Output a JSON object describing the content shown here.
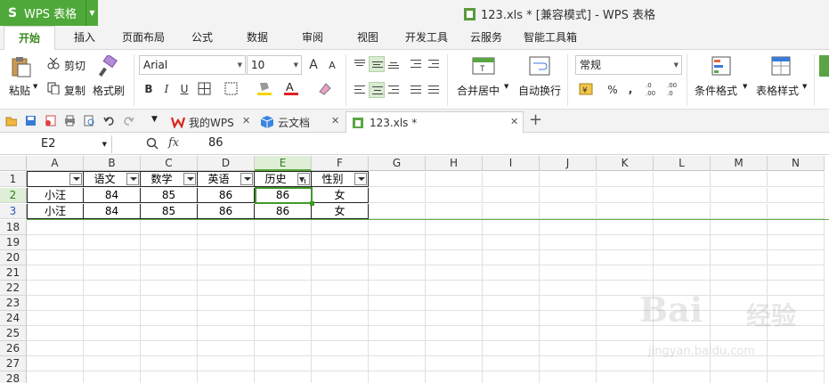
{
  "app": {
    "name": "WPS 表格",
    "logo_glyph": "S"
  },
  "window": {
    "title": "123.xls * [兼容模式] - WPS 表格"
  },
  "menu": {
    "tabs": [
      "开始",
      "插入",
      "页面布局",
      "公式",
      "数据",
      "审阅",
      "视图",
      "开发工具",
      "云服务",
      "智能工具箱"
    ],
    "active": "开始"
  },
  "ribbon": {
    "paste": "粘贴",
    "cut": "剪切",
    "copy": "复制",
    "format_painter": "格式刷",
    "font_name": "Arial",
    "font_size": "10",
    "font_grow": "A",
    "font_shrink": "A",
    "bold": "B",
    "italic": "I",
    "underline": "U",
    "merge_center": "合并居中",
    "wrap_text": "自动换行",
    "number_format": "常规",
    "percent": "%",
    "comma": ",",
    "conditional_format": "条件格式",
    "table_style": "表格样式"
  },
  "doc_tabs": [
    {
      "label": "我的WPS",
      "icon": "wps-logo-icon"
    },
    {
      "label": "云文档",
      "icon": "cloud-cube-icon"
    },
    {
      "label": "123.xls *",
      "icon": "sheet-file-icon"
    }
  ],
  "formula_bar": {
    "cell_ref": "E2",
    "fx": "fx",
    "value": "86"
  },
  "sheet": {
    "columns": [
      "A",
      "B",
      "C",
      "D",
      "E",
      "F",
      "G",
      "H",
      "I",
      "J",
      "K",
      "L",
      "M",
      "N"
    ],
    "row_numbers": [
      "1",
      "2",
      "3",
      "18",
      "19",
      "20",
      "21",
      "22",
      "23",
      "24",
      "25",
      "26",
      "27",
      "28"
    ],
    "header_row": [
      "",
      "语文",
      "数学",
      "英语",
      "历史",
      "性别"
    ],
    "data_rows": [
      [
        "小汪",
        "84",
        "85",
        "86",
        "86",
        "女"
      ],
      [
        "小汪",
        "84",
        "85",
        "86",
        "86",
        "女"
      ]
    ],
    "active_cell": "E2",
    "filtered_column": "E"
  },
  "watermark": {
    "line1": "Bai",
    "line2": "jingyan.baidu.com",
    "glyph": "经验"
  },
  "colors": {
    "accent": "#4fa93a",
    "selection": "#3f9a2a"
  }
}
